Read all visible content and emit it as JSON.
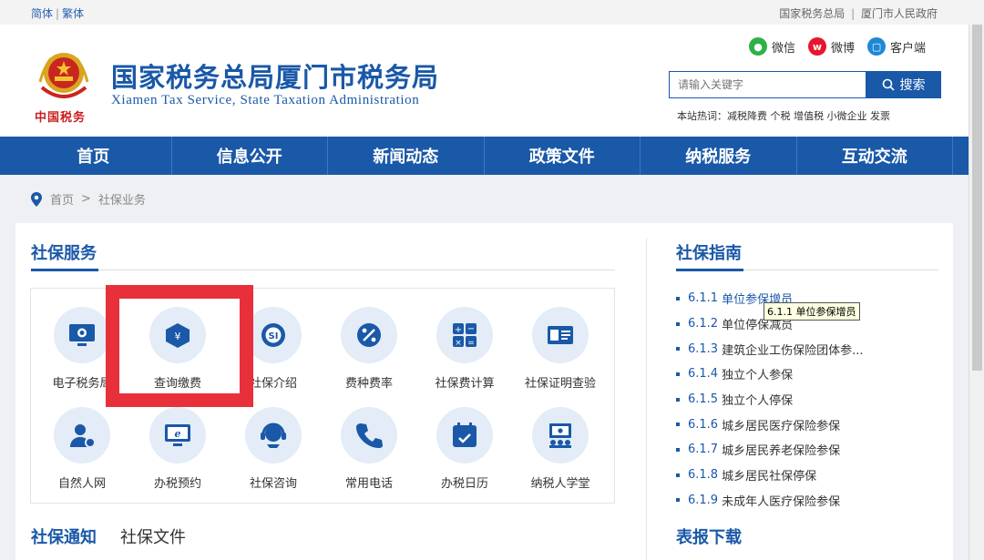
{
  "topbar": {
    "simplified": "简体",
    "traditional": "繁体",
    "link_state_tax": "国家税务总局",
    "link_city_gov": "厦门市人民政府"
  },
  "header": {
    "title": "国家税务总局厦门市税务局",
    "subtitle": "Xiamen Tax Service, State Taxation Administration",
    "emblem_text": "中国税务",
    "social": {
      "wechat": "微信",
      "weibo": "微博",
      "client": "客户端"
    },
    "search_placeholder": "请输入关键字",
    "search_button": "搜索",
    "hot_words": "本站热词：减税降费 个税 增值税 小微企业 发票"
  },
  "nav": [
    "首页",
    "信息公开",
    "新闻动态",
    "政策文件",
    "纳税服务",
    "互动交流"
  ],
  "breadcrumb": {
    "home": "首页",
    "sep": ">",
    "current": "社保业务"
  },
  "services": {
    "title": "社保服务",
    "items": [
      {
        "label": "电子税务局",
        "icon": "monitor-icon"
      },
      {
        "label": "查询缴费",
        "icon": "cube-icon"
      },
      {
        "label": "社保介绍",
        "icon": "si-logo-icon"
      },
      {
        "label": "费种费率",
        "icon": "percent-icon"
      },
      {
        "label": "社保费计算",
        "icon": "calculator-icon"
      },
      {
        "label": "社保证明查验",
        "icon": "id-card-icon"
      },
      {
        "label": "自然人网",
        "icon": "user-icon"
      },
      {
        "label": "办税预约",
        "icon": "e-screen-icon"
      },
      {
        "label": "社保咨询",
        "icon": "headset-icon"
      },
      {
        "label": "常用电话",
        "icon": "phone-icon"
      },
      {
        "label": "办税日历",
        "icon": "calendar-icon"
      },
      {
        "label": "纳税人学堂",
        "icon": "classroom-icon"
      }
    ]
  },
  "bottom_tabs": {
    "notice": "社保通知",
    "files": "社保文件"
  },
  "guide": {
    "title": "社保指南",
    "items": [
      {
        "num": "6.1.1",
        "text": "单位参保增员"
      },
      {
        "num": "6.1.2",
        "text": "单位停保减员"
      },
      {
        "num": "6.1.3",
        "text": "建筑企业工伤保险团体参..."
      },
      {
        "num": "6.1.4",
        "text": "独立个人参保"
      },
      {
        "num": "6.1.5",
        "text": "独立个人停保"
      },
      {
        "num": "6.1.6",
        "text": "城乡居民医疗保险参保"
      },
      {
        "num": "6.1.7",
        "text": "城乡居民养老保险参保"
      },
      {
        "num": "6.1.8",
        "text": "城乡居民社保停保"
      },
      {
        "num": "6.1.9",
        "text": "未成年人医疗保险参保"
      }
    ],
    "tooltip": "6.1.1 单位参保增员"
  },
  "downloads": {
    "title": "表报下载"
  },
  "colors": {
    "brand": "#1a58a8",
    "highlight": "#e8303a",
    "icon_bg": "#e3ecf7"
  }
}
